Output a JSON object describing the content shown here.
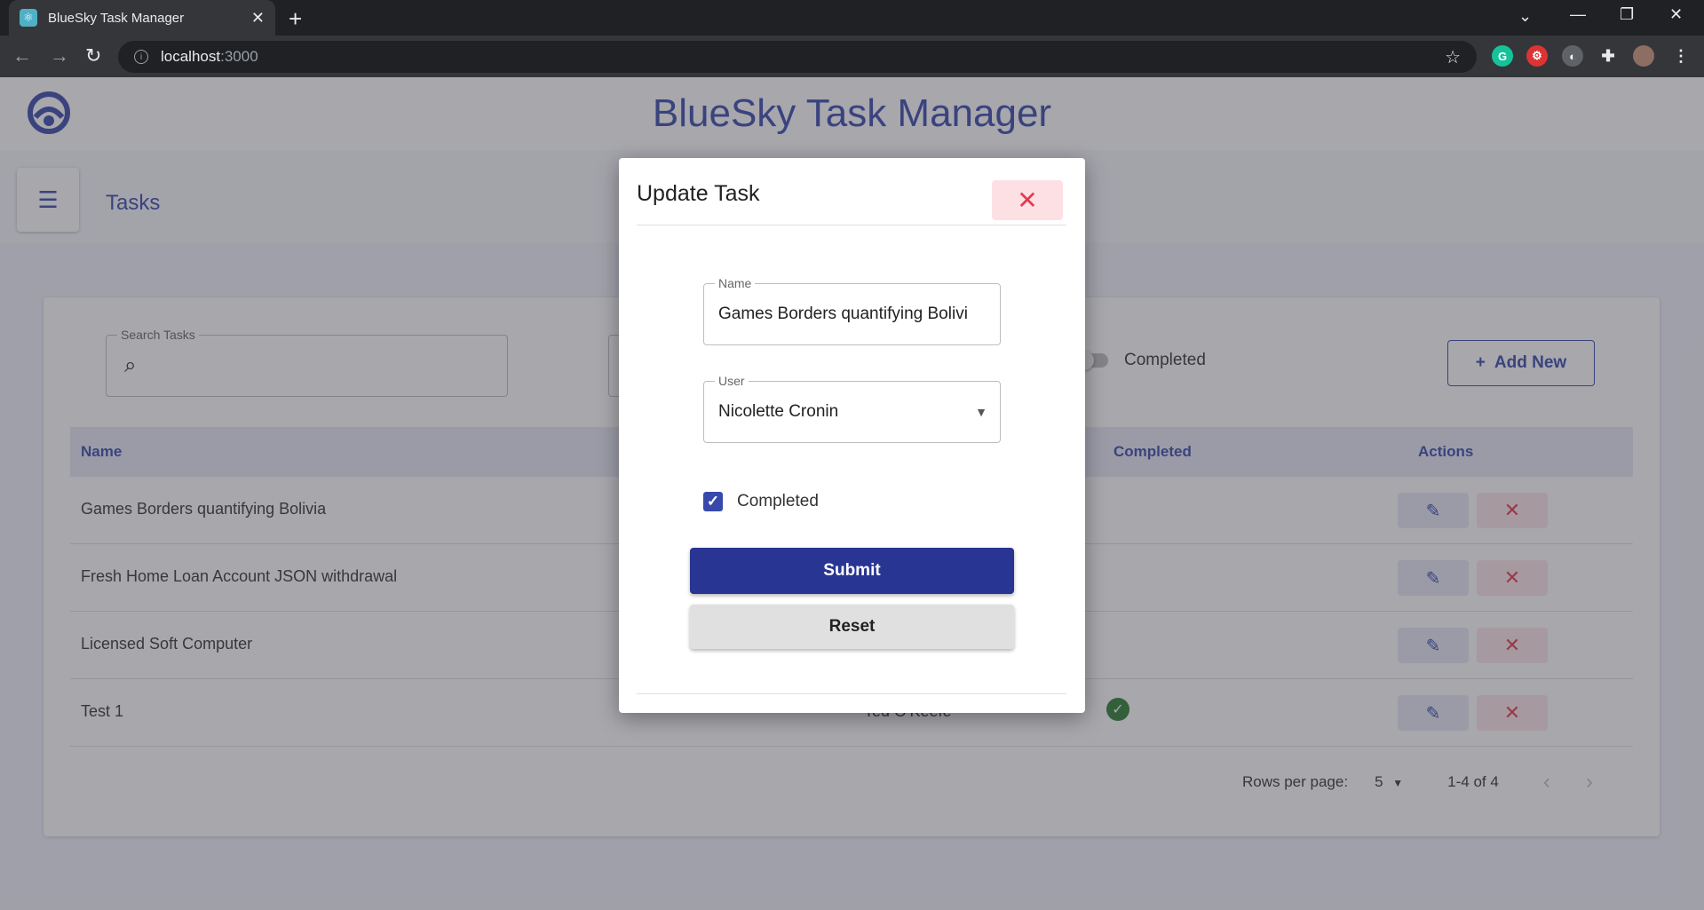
{
  "browser": {
    "tab_title": "BlueSky Task Manager",
    "url_host": "localhost",
    "url_port": ":3000"
  },
  "app": {
    "title": "BlueSky Task Manager",
    "page_label": "Tasks"
  },
  "filters": {
    "search_label": "Search Tasks",
    "completed_toggle_label": "Completed",
    "add_new_label": "Add New"
  },
  "table": {
    "headers": {
      "name": "Name",
      "completed": "Completed",
      "actions": "Actions"
    },
    "rows": [
      {
        "name": "Games Borders quantifying Bolivia",
        "user": "",
        "completed": false
      },
      {
        "name": "Fresh Home Loan Account JSON withdrawal",
        "user": "",
        "completed": false
      },
      {
        "name": "Licensed Soft Computer",
        "user": "",
        "completed": false
      },
      {
        "name": "Test 1",
        "user": "Ted O'Keefe",
        "completed": true
      }
    ]
  },
  "pagination": {
    "rows_per_page_label": "Rows per page:",
    "rows_per_page_value": "5",
    "range": "1-4 of 4"
  },
  "modal": {
    "title": "Update Task",
    "name_label": "Name",
    "name_value": "Games Borders quantifying Bolivi",
    "user_label": "User",
    "user_value": "Nicolette Cronin",
    "completed_label": "Completed",
    "completed_checked": true,
    "submit_label": "Submit",
    "reset_label": "Reset"
  },
  "colors": {
    "primary": "#3949ab",
    "primary_dark": "#283593",
    "danger": "#e53950",
    "success": "#2e7d32"
  }
}
